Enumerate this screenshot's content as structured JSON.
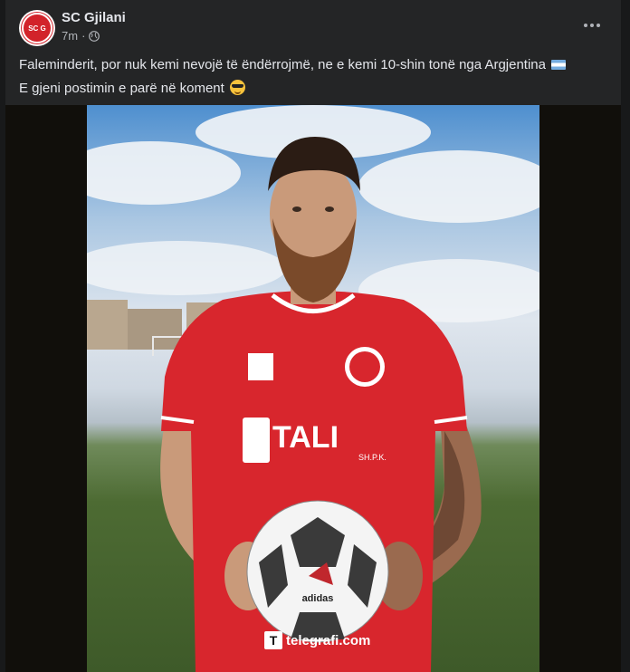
{
  "post": {
    "author": "SC Gjilani",
    "time": "7m",
    "avatar_text": "SC G",
    "caption_line1": "Faleminderit, por nuk kemi nevojë të ëndërrojmë, ne e kemi 10-shin tonë nga Argjentina",
    "caption_line2": "E gjeni postimin e parë në koment",
    "flag_icon": "argentina-flag-emoji",
    "emoji_icon": "smiling-face-with-sunglasses-emoji"
  },
  "photo": {
    "jersey_sponsor": "TALI",
    "jersey_sponsor_sub": "SH.P.K.",
    "ball_brand": "adidas",
    "watermark": "telegrafi.com",
    "watermark_mark": "T",
    "colors": {
      "jersey": "#d8262d",
      "sky": "#4e8fcf",
      "grass": "#4d6b33"
    }
  },
  "colors": {
    "background": "#18191a",
    "card": "#242526",
    "text_primary": "#e4e6eb",
    "text_secondary": "#b0b3b8"
  }
}
